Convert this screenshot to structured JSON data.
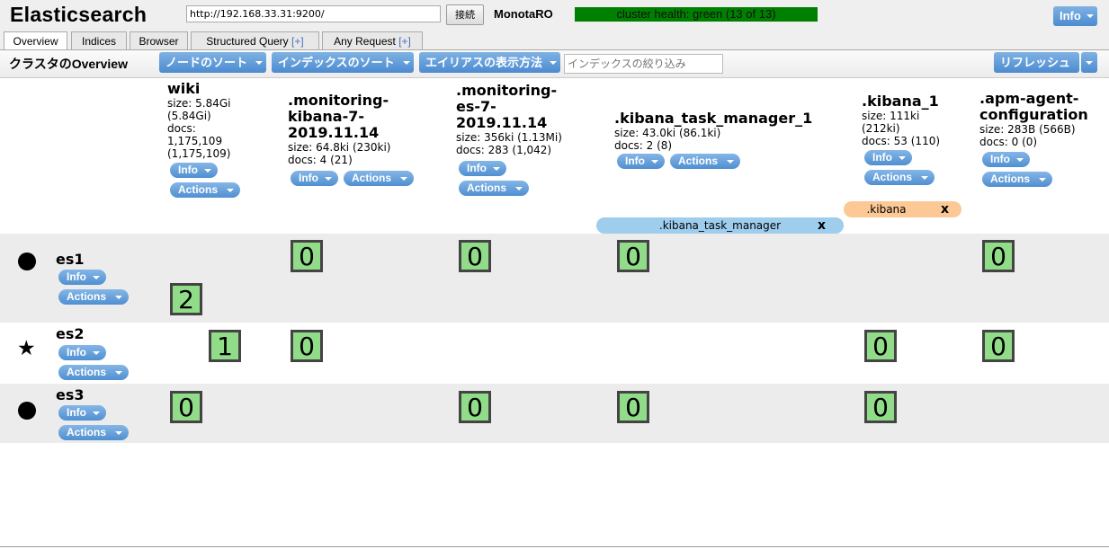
{
  "header": {
    "title": "Elasticsearch",
    "url_value": "http://192.168.33.31:9200/",
    "connect_label": "接続",
    "cluster_name": "MonotaRO",
    "health": "cluster health: green (13 of 13)",
    "health_color": "#008000",
    "info_label": "Info"
  },
  "tabs": [
    {
      "label": "Overview"
    },
    {
      "label": "Indices"
    },
    {
      "label": "Browser"
    },
    {
      "label": "Structured Query",
      "plus": "[+]"
    },
    {
      "label": "Any Request",
      "plus": "[+]"
    }
  ],
  "toolbar": {
    "title": "クラスタのOverview",
    "sort_nodes": "ノードのソート",
    "sort_indices": "インデックスのソート",
    "alias_display": "エイリアスの表示方法",
    "filter_placeholder": "インデックスの絞り込み",
    "refresh": "リフレッシュ"
  },
  "common": {
    "info": "Info",
    "actions": "Actions",
    "alias_close": "x"
  },
  "indices": [
    {
      "name": "wiki",
      "size": "size: 5.84Gi",
      "size2": "(5.84Gi)",
      "docs": "docs:",
      "docs2": "1,175,109",
      "docs3": "(1,175,109)"
    },
    {
      "name1": ".monitoring-",
      "name2": "kibana-7-",
      "name3": "2019.11.14",
      "size": "size: 64.8ki (230ki)",
      "docs": "docs: 4 (21)"
    },
    {
      "name1": ".monitoring-",
      "name2": "es-7-",
      "name3": "2019.11.14",
      "size": "size: 356ki (1.13Mi)",
      "docs": "docs: 283 (1,042)"
    },
    {
      "name": ".kibana_task_manager_1",
      "size": "size: 43.0ki (86.1ki)",
      "docs": "docs: 2 (8)"
    },
    {
      "name": ".kibana_1",
      "size": "size: 111ki",
      "size2": "(212ki)",
      "docs": "docs: 53 (110)"
    },
    {
      "name1": ".apm-agent-",
      "name2": "configuration",
      "size": "size: 283B (566B)",
      "docs": "docs: 0 (0)"
    }
  ],
  "aliases": [
    {
      "name": ".kibana_task_manager",
      "color": "#9fcdee"
    },
    {
      "name": ".kibana",
      "color": "#fbc896"
    }
  ],
  "nodes": [
    {
      "name": "es1",
      "icon": "circle"
    },
    {
      "name": "es2",
      "icon": "star"
    },
    {
      "name": "es3",
      "icon": "circle"
    }
  ],
  "shards": {
    "es1": [
      "0",
      "0",
      "0",
      "0",
      "2"
    ],
    "es2": [
      "1",
      "0",
      "0",
      "0"
    ],
    "es3": [
      "0",
      "0",
      "0",
      "0"
    ]
  }
}
